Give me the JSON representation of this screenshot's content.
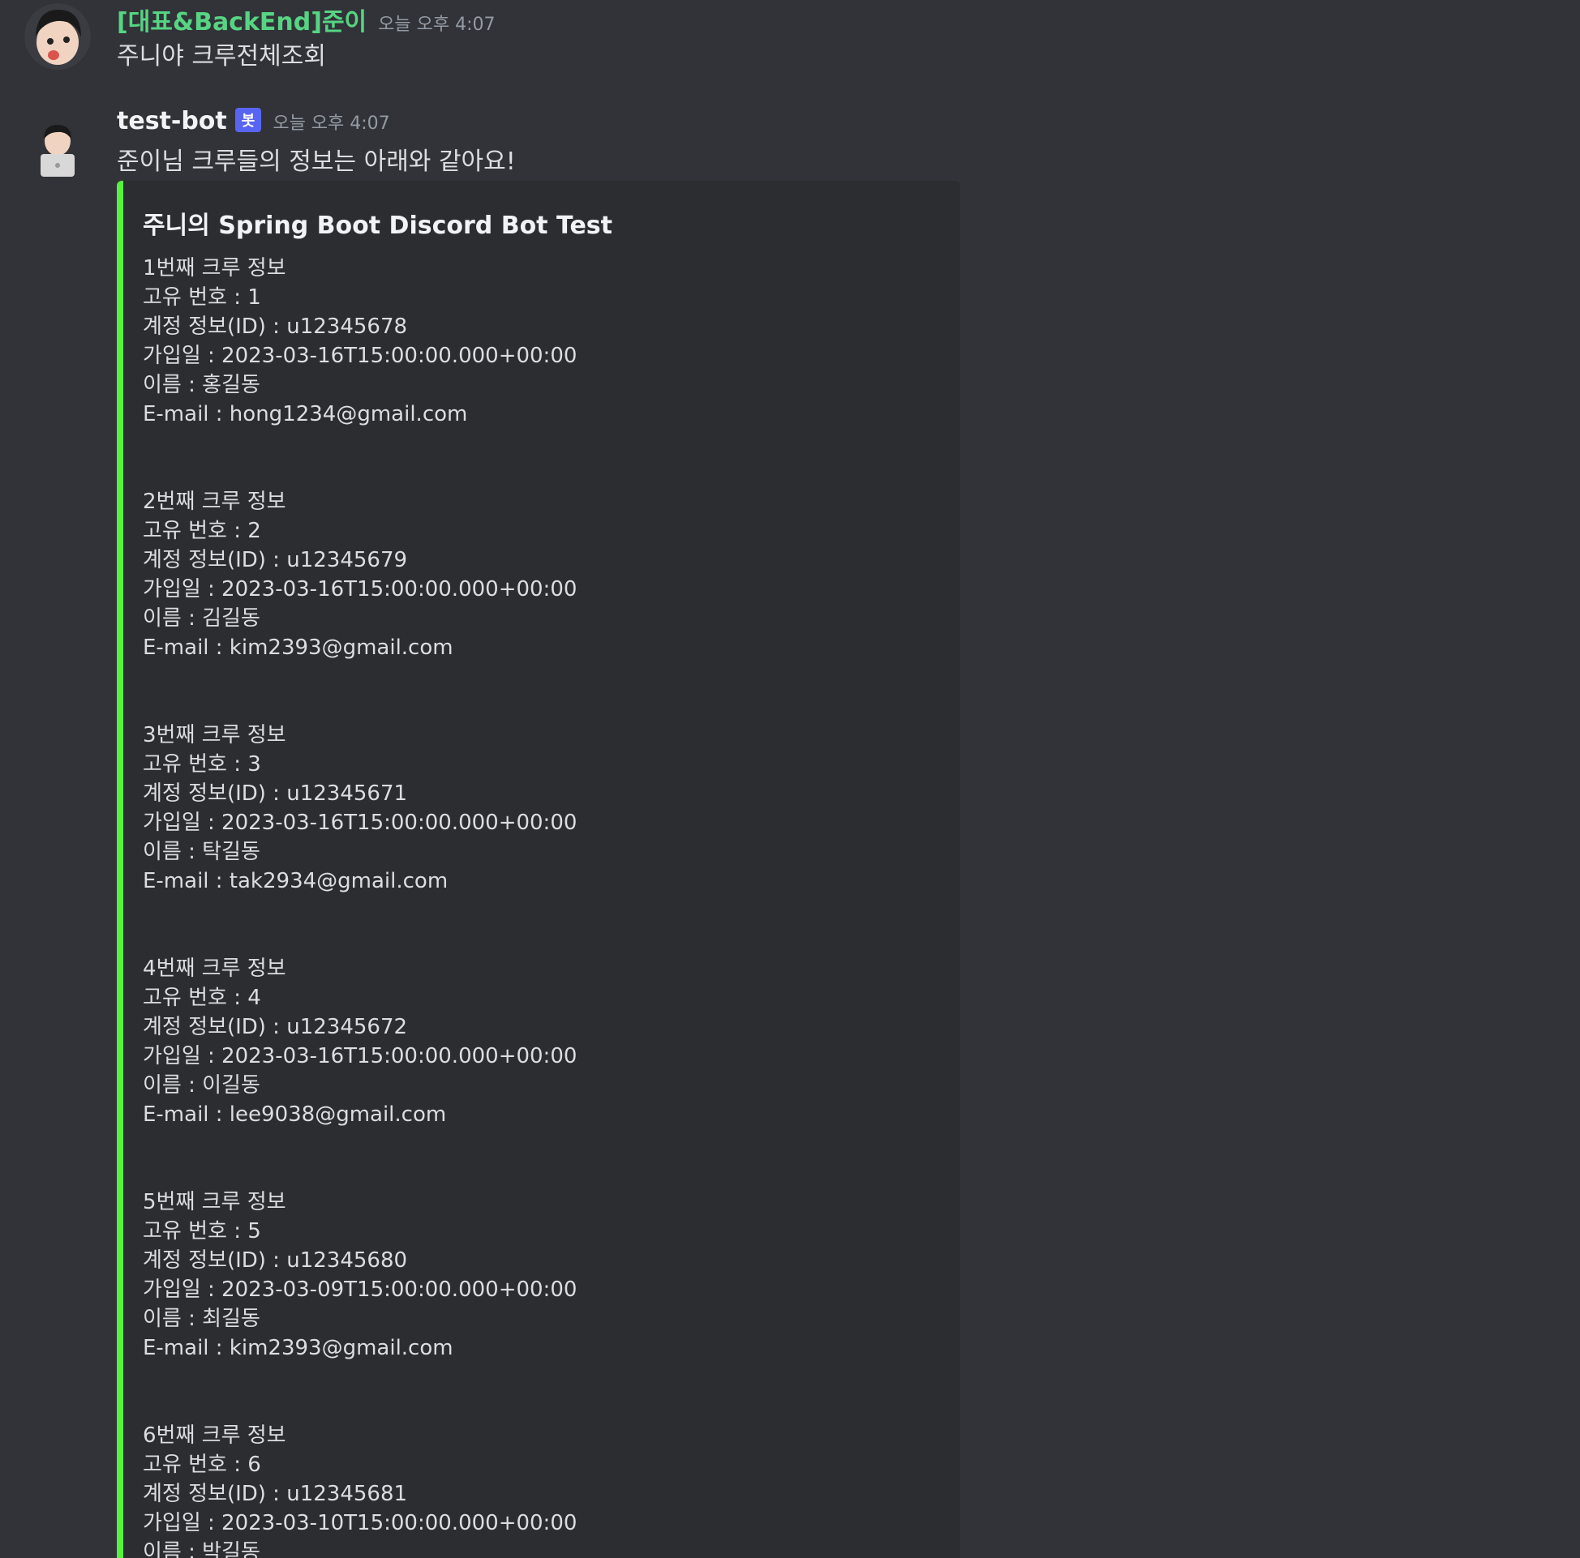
{
  "messages": [
    {
      "username": "[대표&BackEnd]준이",
      "username_color": "#57d483",
      "timestamp": "오늘 오후 4:07",
      "text": "주니야 크루전체조회"
    },
    {
      "username": "test-bot",
      "username_color": "#f2f3f5",
      "badge": "봇",
      "timestamp": "오늘 오후 4:07",
      "text": "준이님 크루들의 정보는 아래와 같아요!"
    }
  ],
  "embed": {
    "accent_color": "#57f23f",
    "title": "주니의 Spring Boot Discord Bot Test",
    "crews": [
      {
        "header": "1번째 크루 정보",
        "unique_no": "고유 번호 : 1",
        "account_id": "계정 정보(ID) : u12345678",
        "joined": "가입일 : 2023-03-16T15:00:00.000+00:00",
        "name": "이름 : 홍길동",
        "email": "E-mail : hong1234@gmail.com"
      },
      {
        "header": "2번째 크루 정보",
        "unique_no": "고유 번호 : 2",
        "account_id": "계정 정보(ID) : u12345679",
        "joined": "가입일 : 2023-03-16T15:00:00.000+00:00",
        "name": "이름 : 김길동",
        "email": "E-mail : kim2393@gmail.com"
      },
      {
        "header": "3번째 크루 정보",
        "unique_no": "고유 번호 : 3",
        "account_id": "계정 정보(ID) : u12345671",
        "joined": "가입일 : 2023-03-16T15:00:00.000+00:00",
        "name": "이름 : 탁길동",
        "email": "E-mail : tak2934@gmail.com"
      },
      {
        "header": "4번째 크루 정보",
        "unique_no": "고유 번호 : 4",
        "account_id": "계정 정보(ID) : u12345672",
        "joined": "가입일 : 2023-03-16T15:00:00.000+00:00",
        "name": "이름 : 이길동",
        "email": "E-mail : lee9038@gmail.com"
      },
      {
        "header": "5번째 크루 정보",
        "unique_no": "고유 번호 : 5",
        "account_id": "계정 정보(ID) : u12345680",
        "joined": "가입일 : 2023-03-09T15:00:00.000+00:00",
        "name": "이름 : 최길동",
        "email": "E-mail : kim2393@gmail.com"
      },
      {
        "header": "6번째 크루 정보",
        "unique_no": "고유 번호 : 6",
        "account_id": "계정 정보(ID) : u12345681",
        "joined": "가입일 : 2023-03-10T15:00:00.000+00:00",
        "name": "이름 : 박길동",
        "email": ""
      }
    ]
  }
}
